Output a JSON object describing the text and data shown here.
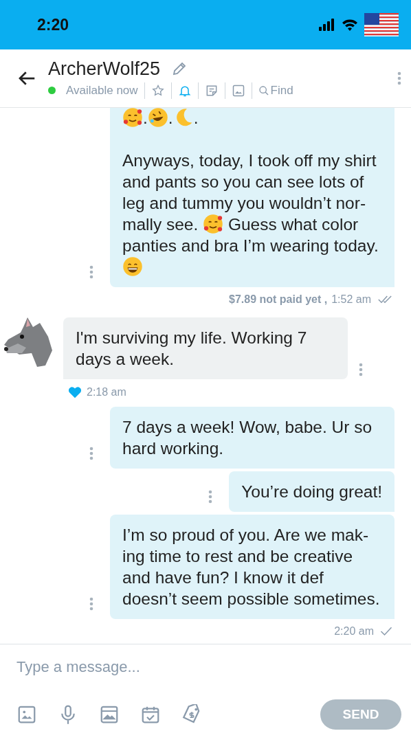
{
  "status_bar": {
    "time": "2:20"
  },
  "header": {
    "title": "ArcherWolf25",
    "status": "Available now",
    "online": true,
    "notifications_on": true,
    "find_label": "Find"
  },
  "messages": [
    {
      "kind": "sent",
      "paragraphs": [
        [
          {
            "kind": "hearts_emoji"
          },
          {
            "kind": "text",
            "text": "."
          },
          {
            "kind": "rofl_emoji"
          },
          {
            "kind": "text",
            "text": "."
          },
          {
            "kind": "moon_emoji"
          },
          {
            "kind": "text",
            "text": "."
          }
        ],
        [
          {
            "kind": "text",
            "text": "Anyways, today, I took off my shirt and pants so you can see lots of leg and tummy you wouldn’t nor-mally see. "
          },
          {
            "kind": "hearts_emoji"
          },
          {
            "kind": "text",
            "text": " Guess what color panties and bra I’m wearing today."
          },
          {
            "kind": "grin_emoji"
          }
        ]
      ],
      "price": "$7.89 not paid yet ,",
      "time": "1:52 am",
      "read": true
    },
    {
      "kind": "received",
      "paragraphs": [
        [
          {
            "kind": "text",
            "text": "I'm surviving my life. Working 7 days a week."
          }
        ]
      ],
      "liked": true,
      "time": "2:18 am"
    },
    {
      "kind": "sent",
      "paragraphs": [
        [
          {
            "kind": "text",
            "text": "7 days a week! Wow, babe. Ur so hard working."
          }
        ]
      ]
    },
    {
      "kind": "sent",
      "paragraphs": [
        [
          {
            "kind": "text",
            "text": "You’re doing great!"
          }
        ]
      ]
    },
    {
      "kind": "sent",
      "paragraphs": [
        [
          {
            "kind": "text",
            "text": "I’m so proud of you. Are we mak-ing time to rest and be creative and have fun? I know it def doesn’t seem possible sometimes."
          }
        ]
      ],
      "time": "2:20 am",
      "read": false
    }
  ],
  "composer": {
    "placeholder": "Type a message...",
    "send_label": "SEND",
    "send_disabled": true
  }
}
